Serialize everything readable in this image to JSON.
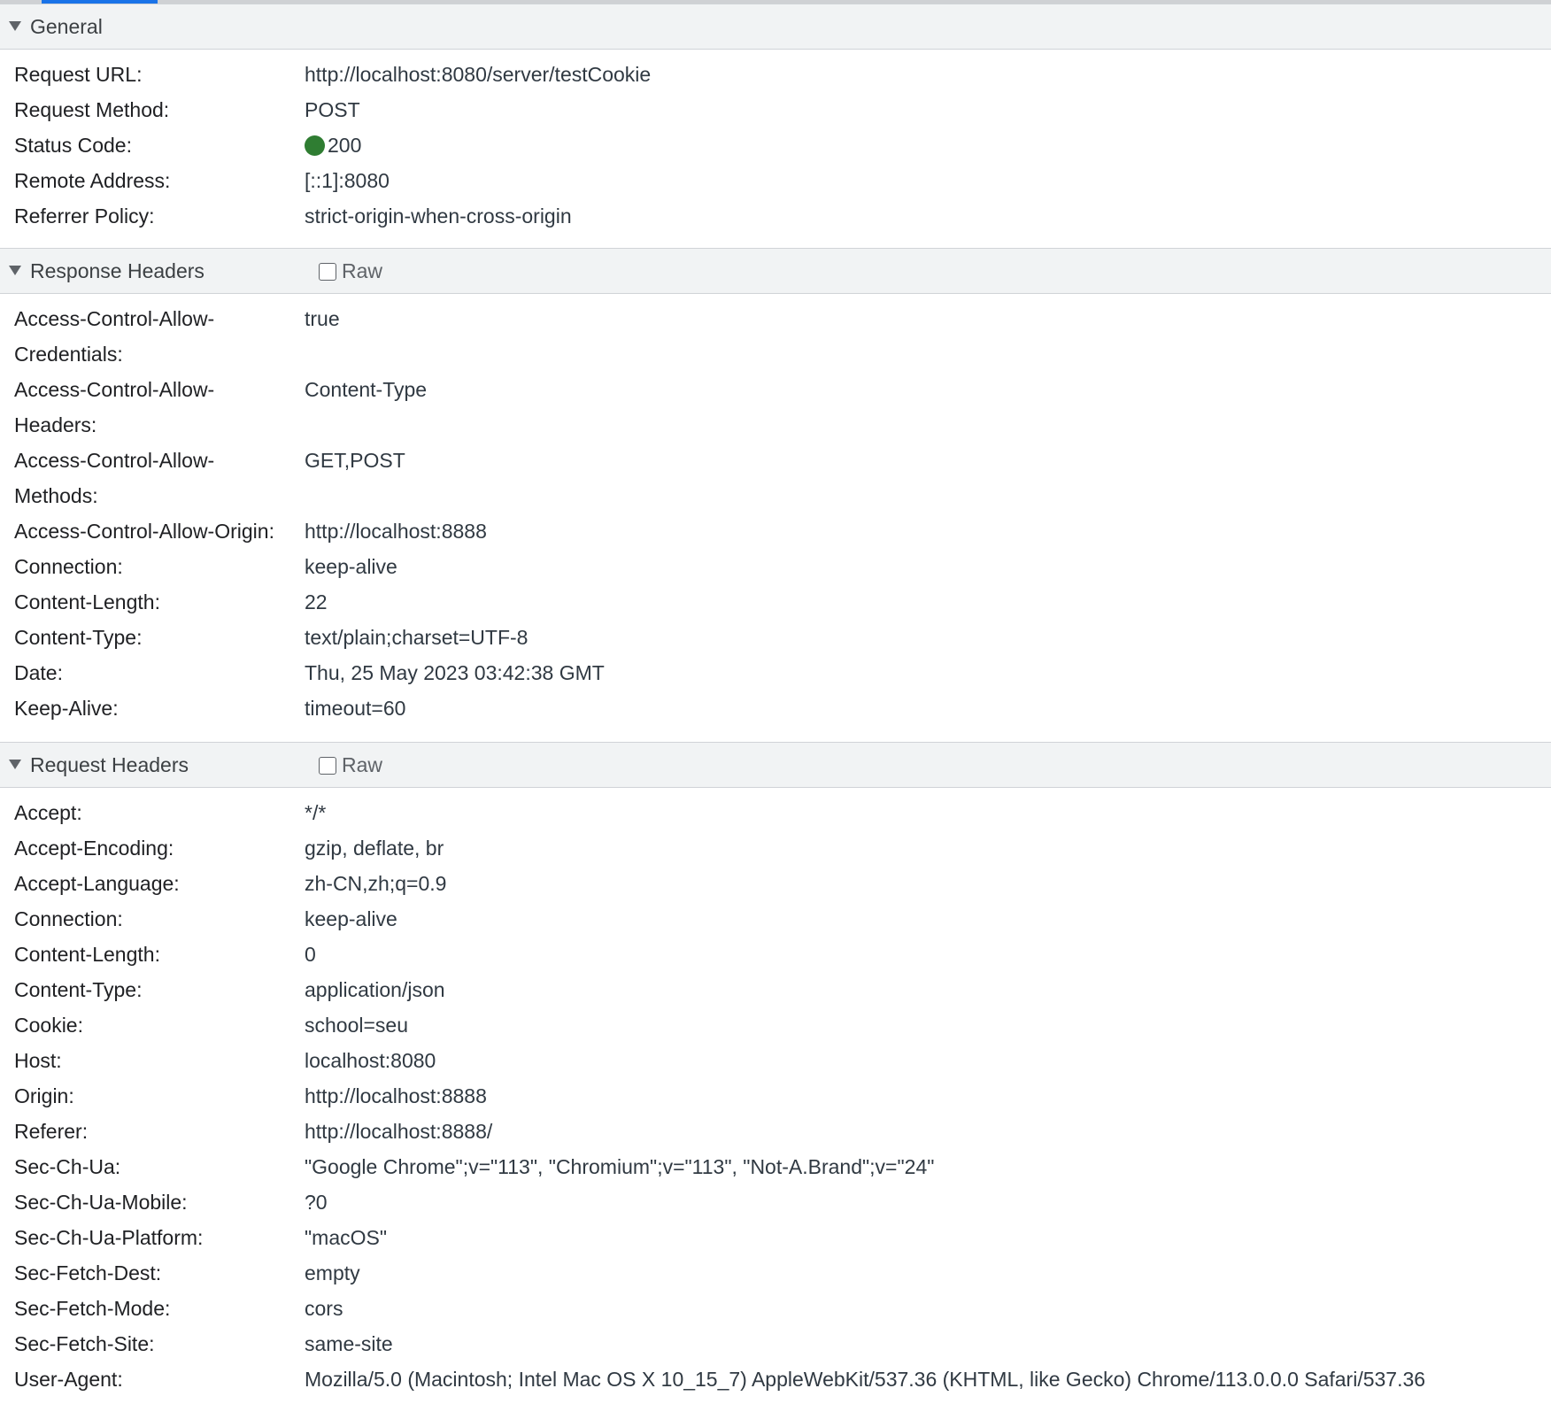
{
  "general": {
    "title": "General",
    "rows": [
      {
        "name": "Request URL:",
        "value": "http://localhost:8080/server/testCookie"
      },
      {
        "name": "Request Method:",
        "value": "POST"
      },
      {
        "name": "Status Code:",
        "value": "200",
        "status_color": "#2f7d32"
      },
      {
        "name": "Remote Address:",
        "value": "[::1]:8080"
      },
      {
        "name": "Referrer Policy:",
        "value": "strict-origin-when-cross-origin"
      }
    ]
  },
  "response_headers": {
    "title": "Response Headers",
    "raw_label": "Raw",
    "raw_checked": false,
    "rows": [
      {
        "name": "Access-Control-Allow-Credentials:",
        "value": "true"
      },
      {
        "name": "Access-Control-Allow-Headers:",
        "value": "Content-Type"
      },
      {
        "name": "Access-Control-Allow-Methods:",
        "value": "GET,POST"
      },
      {
        "name": "Access-Control-Allow-Origin:",
        "value": "http://localhost:8888"
      },
      {
        "name": "Connection:",
        "value": "keep-alive"
      },
      {
        "name": "Content-Length:",
        "value": "22"
      },
      {
        "name": "Content-Type:",
        "value": "text/plain;charset=UTF-8"
      },
      {
        "name": "Date:",
        "value": "Thu, 25 May 2023 03:42:38 GMT"
      },
      {
        "name": "Keep-Alive:",
        "value": "timeout=60"
      }
    ]
  },
  "request_headers": {
    "title": "Request Headers",
    "raw_label": "Raw",
    "raw_checked": false,
    "rows": [
      {
        "name": "Accept:",
        "value": "*/*"
      },
      {
        "name": "Accept-Encoding:",
        "value": "gzip, deflate, br"
      },
      {
        "name": "Accept-Language:",
        "value": "zh-CN,zh;q=0.9"
      },
      {
        "name": "Connection:",
        "value": "keep-alive"
      },
      {
        "name": "Content-Length:",
        "value": "0"
      },
      {
        "name": "Content-Type:",
        "value": "application/json"
      },
      {
        "name": "Cookie:",
        "value": "school=seu"
      },
      {
        "name": "Host:",
        "value": "localhost:8080"
      },
      {
        "name": "Origin:",
        "value": "http://localhost:8888"
      },
      {
        "name": "Referer:",
        "value": "http://localhost:8888/"
      },
      {
        "name": "Sec-Ch-Ua:",
        "value": "\"Google Chrome\";v=\"113\", \"Chromium\";v=\"113\", \"Not-A.Brand\";v=\"24\""
      },
      {
        "name": "Sec-Ch-Ua-Mobile:",
        "value": "?0"
      },
      {
        "name": "Sec-Ch-Ua-Platform:",
        "value": "\"macOS\""
      },
      {
        "name": "Sec-Fetch-Dest:",
        "value": "empty"
      },
      {
        "name": "Sec-Fetch-Mode:",
        "value": "cors"
      },
      {
        "name": "Sec-Fetch-Site:",
        "value": "same-site"
      },
      {
        "name": "User-Agent:",
        "value": "Mozilla/5.0 (Macintosh; Intel Mac OS X 10_15_7) AppleWebKit/537.36 (KHTML, like Gecko) Chrome/113.0.0.0 Safari/537.36"
      }
    ]
  }
}
